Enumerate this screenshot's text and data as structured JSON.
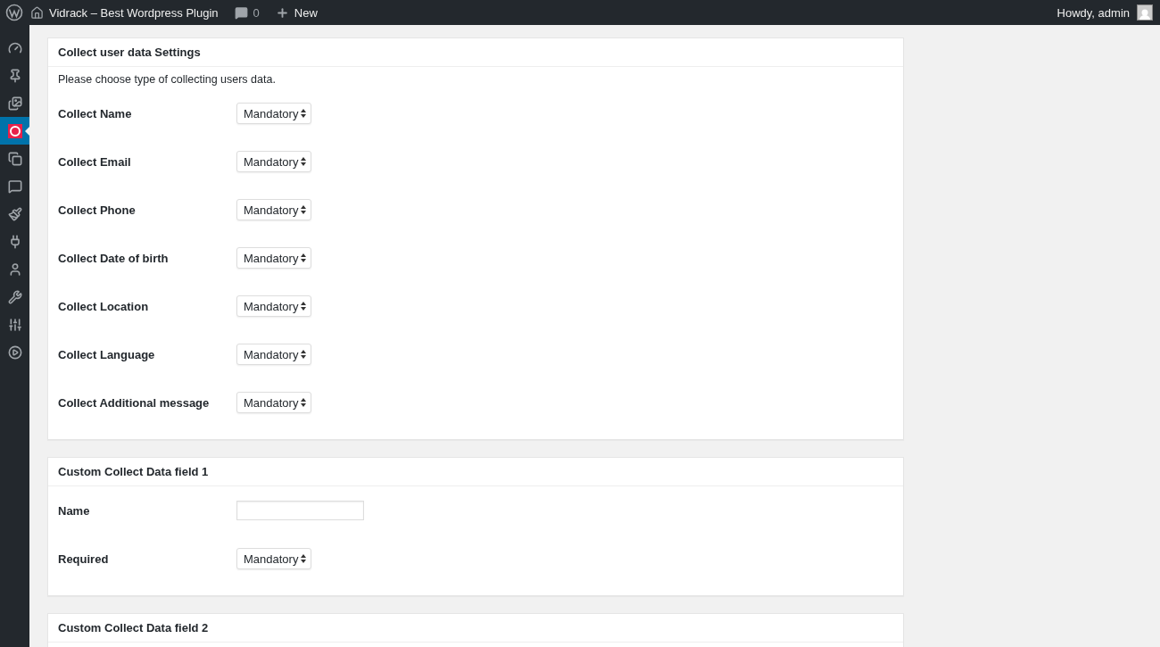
{
  "admin_bar": {
    "site_title": "Vidrack – Best Wordpress Plugin",
    "comments_count": "0",
    "new_label": "New",
    "greeting": "Howdy, admin"
  },
  "sidebar": {
    "items": [
      {
        "kind": "dashboard",
        "selected": false
      },
      {
        "kind": "posts",
        "selected": false
      },
      {
        "kind": "media",
        "selected": false
      },
      {
        "kind": "plugin",
        "selected": true
      },
      {
        "kind": "pages",
        "selected": false
      },
      {
        "kind": "comments",
        "selected": false
      },
      {
        "kind": "appearance",
        "selected": false
      },
      {
        "kind": "plugins",
        "selected": false
      },
      {
        "kind": "users",
        "selected": false
      },
      {
        "kind": "tools",
        "selected": false
      },
      {
        "kind": "settings",
        "selected": false
      },
      {
        "kind": "video",
        "selected": false
      }
    ]
  },
  "panels": [
    {
      "title": "Collect user data Settings",
      "description": "Please choose type of collecting users data.",
      "rows": [
        {
          "label": "Collect Name",
          "kind": "select",
          "value": "Mandatory"
        },
        {
          "label": "Collect Email",
          "kind": "select",
          "value": "Mandatory"
        },
        {
          "label": "Collect Phone",
          "kind": "select",
          "value": "Mandatory"
        },
        {
          "label": "Collect Date of birth",
          "kind": "select",
          "value": "Mandatory"
        },
        {
          "label": "Collect Location",
          "kind": "select",
          "value": "Mandatory"
        },
        {
          "label": "Collect Language",
          "kind": "select",
          "value": "Mandatory"
        },
        {
          "label": "Collect Additional message",
          "kind": "select",
          "value": "Mandatory"
        }
      ]
    },
    {
      "title": "Custom Collect Data field 1",
      "rows": [
        {
          "label": "Name",
          "kind": "input"
        },
        {
          "label": "Required",
          "kind": "select",
          "value": "Mandatory"
        }
      ]
    },
    {
      "title": "Custom Collect Data field 2"
    }
  ]
}
